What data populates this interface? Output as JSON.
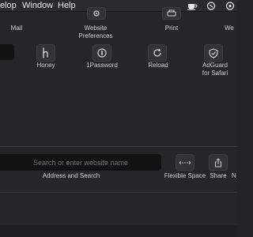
{
  "menubar": {
    "items": [
      "elop",
      "Window",
      "Help"
    ]
  },
  "toolbar_items_row1": [
    {
      "label": "Mail",
      "icon": "mail-icon"
    },
    {
      "label": "Website\nPreferences",
      "icon": "gear-icon"
    },
    {
      "label": "Print",
      "icon": "printer-icon"
    },
    {
      "label": "We",
      "icon": "web-icon"
    }
  ],
  "toolbar_items_row2": [
    {
      "label": "Honey",
      "icon": "honey-icon"
    },
    {
      "label": "1Password",
      "icon": "onepassword-icon"
    },
    {
      "label": "Reload",
      "icon": "reload-icon"
    },
    {
      "label": "AdGuard\nfor Safari",
      "icon": "adguard-shield-icon"
    }
  ],
  "default_bar": {
    "search_placeholder": "Search or enter website name",
    "address_label": "Address and Search",
    "flexible_space_label": "Flexible Space",
    "share_label": "Share",
    "next_label": "N"
  },
  "colors": {
    "background": "#262628",
    "menubar": "#2a2a2c",
    "field": "#121213"
  }
}
